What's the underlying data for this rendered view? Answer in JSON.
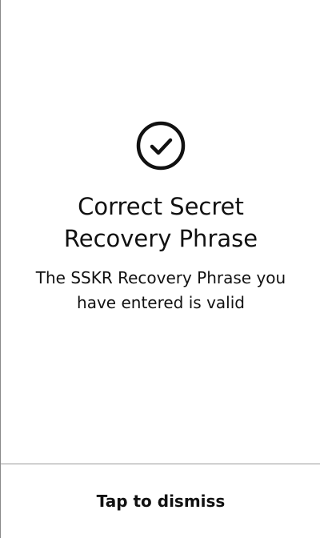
{
  "dialog": {
    "icon": "check-circle-icon",
    "title": "Correct Secret Recovery Phrase",
    "message": "The SSKR Recovery Phrase you have entered is valid",
    "dismiss_label": "Tap to dismiss"
  },
  "colors": {
    "background": "#ffffff",
    "text": "#111111",
    "divider": "#9a9a9a"
  }
}
